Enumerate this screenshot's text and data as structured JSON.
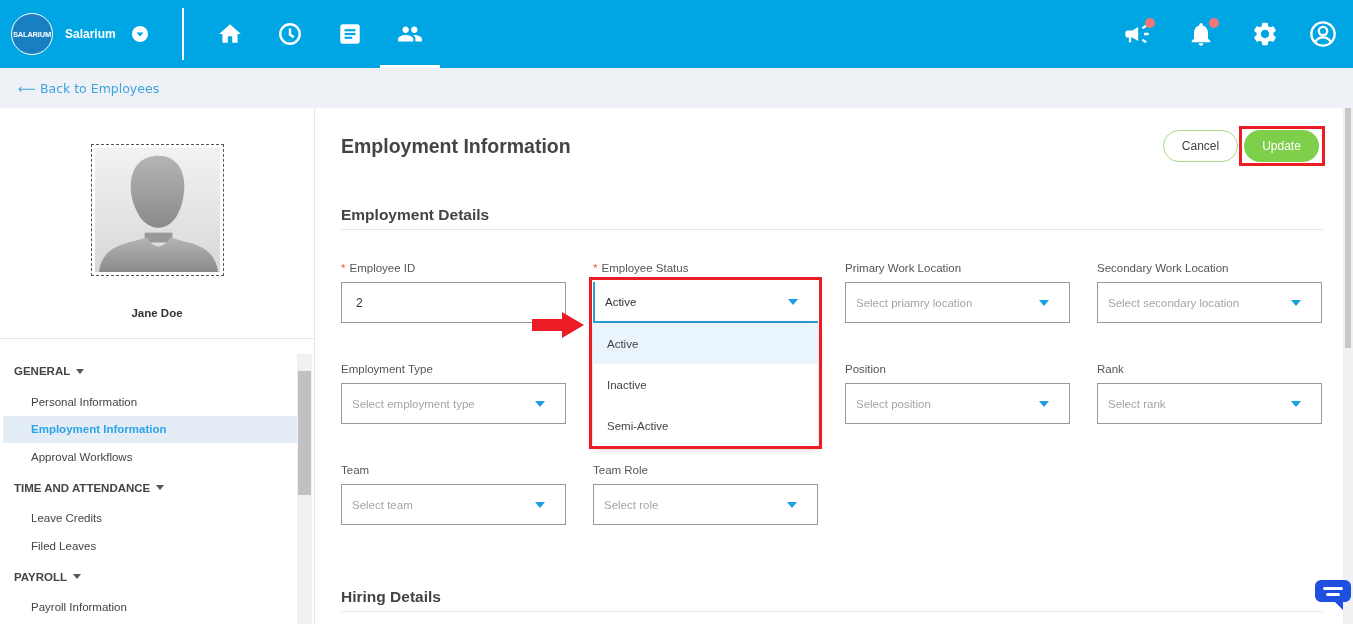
{
  "topbar": {
    "logo_text": "SALARIUM",
    "brand": "Salarium",
    "nav": [
      {
        "selected": false
      },
      {
        "selected": false
      },
      {
        "selected": false
      },
      {
        "selected": true
      }
    ],
    "actions": [
      {
        "badge": true
      },
      {
        "badge": true
      },
      {
        "badge": false
      },
      {
        "badge": false
      }
    ]
  },
  "back_link": "⟵ Back to Employees",
  "sidebar": {
    "employee_name": "Jane Doe",
    "sections": [
      {
        "title": "GENERAL",
        "expanded": true,
        "items": [
          {
            "label": "Personal Information",
            "selected": false
          },
          {
            "label": "Employment Information",
            "selected": true
          },
          {
            "label": "Approval Workflows",
            "selected": false
          }
        ]
      },
      {
        "title": "TIME AND ATTENDANCE",
        "expanded": true,
        "items": [
          {
            "label": "Leave Credits",
            "selected": false
          },
          {
            "label": "Filed Leaves",
            "selected": false
          }
        ]
      },
      {
        "title": "PAYROLL",
        "expanded": true,
        "items": [
          {
            "label": "Payroll Information",
            "selected": false
          }
        ]
      }
    ]
  },
  "page": {
    "title": "Employment Information",
    "buttons": [
      {
        "label": "Cancel",
        "kind": "outline",
        "highlighted": false
      },
      {
        "label": "Update",
        "kind": "primary",
        "highlighted": true
      }
    ],
    "sections": [
      {
        "title": "Employment Details",
        "rows": [
          [
            {
              "required_mark": "*",
              "label": "Employee ID",
              "kind": "text",
              "value": "2"
            },
            {
              "required_mark": "*",
              "label": "Employee Status",
              "kind": "select",
              "value": "Active",
              "open": true,
              "highlighted": true,
              "options": [
                {
                  "label": "Active",
                  "selected": true
                },
                {
                  "label": "Inactive",
                  "selected": false
                },
                {
                  "label": "Semi-Active",
                  "selected": false
                }
              ]
            },
            {
              "label": "Primary Work Location",
              "kind": "select",
              "placeholder": "Select priamry location"
            },
            {
              "label": "Secondary Work Location",
              "kind": "select",
              "placeholder": "Select secondary location"
            }
          ],
          [
            {
              "label": "Employment Type",
              "kind": "select",
              "placeholder": "Select employment type"
            },
            null,
            {
              "label": "Position",
              "kind": "select",
              "placeholder": "Select position"
            },
            {
              "label": "Rank",
              "kind": "select",
              "placeholder": "Select rank"
            }
          ],
          [
            {
              "label": "Team",
              "kind": "select",
              "placeholder": "Select team"
            },
            {
              "label": "Team Role",
              "kind": "select",
              "placeholder": "Select role"
            }
          ]
        ]
      },
      {
        "title": "Hiring Details"
      }
    ]
  }
}
